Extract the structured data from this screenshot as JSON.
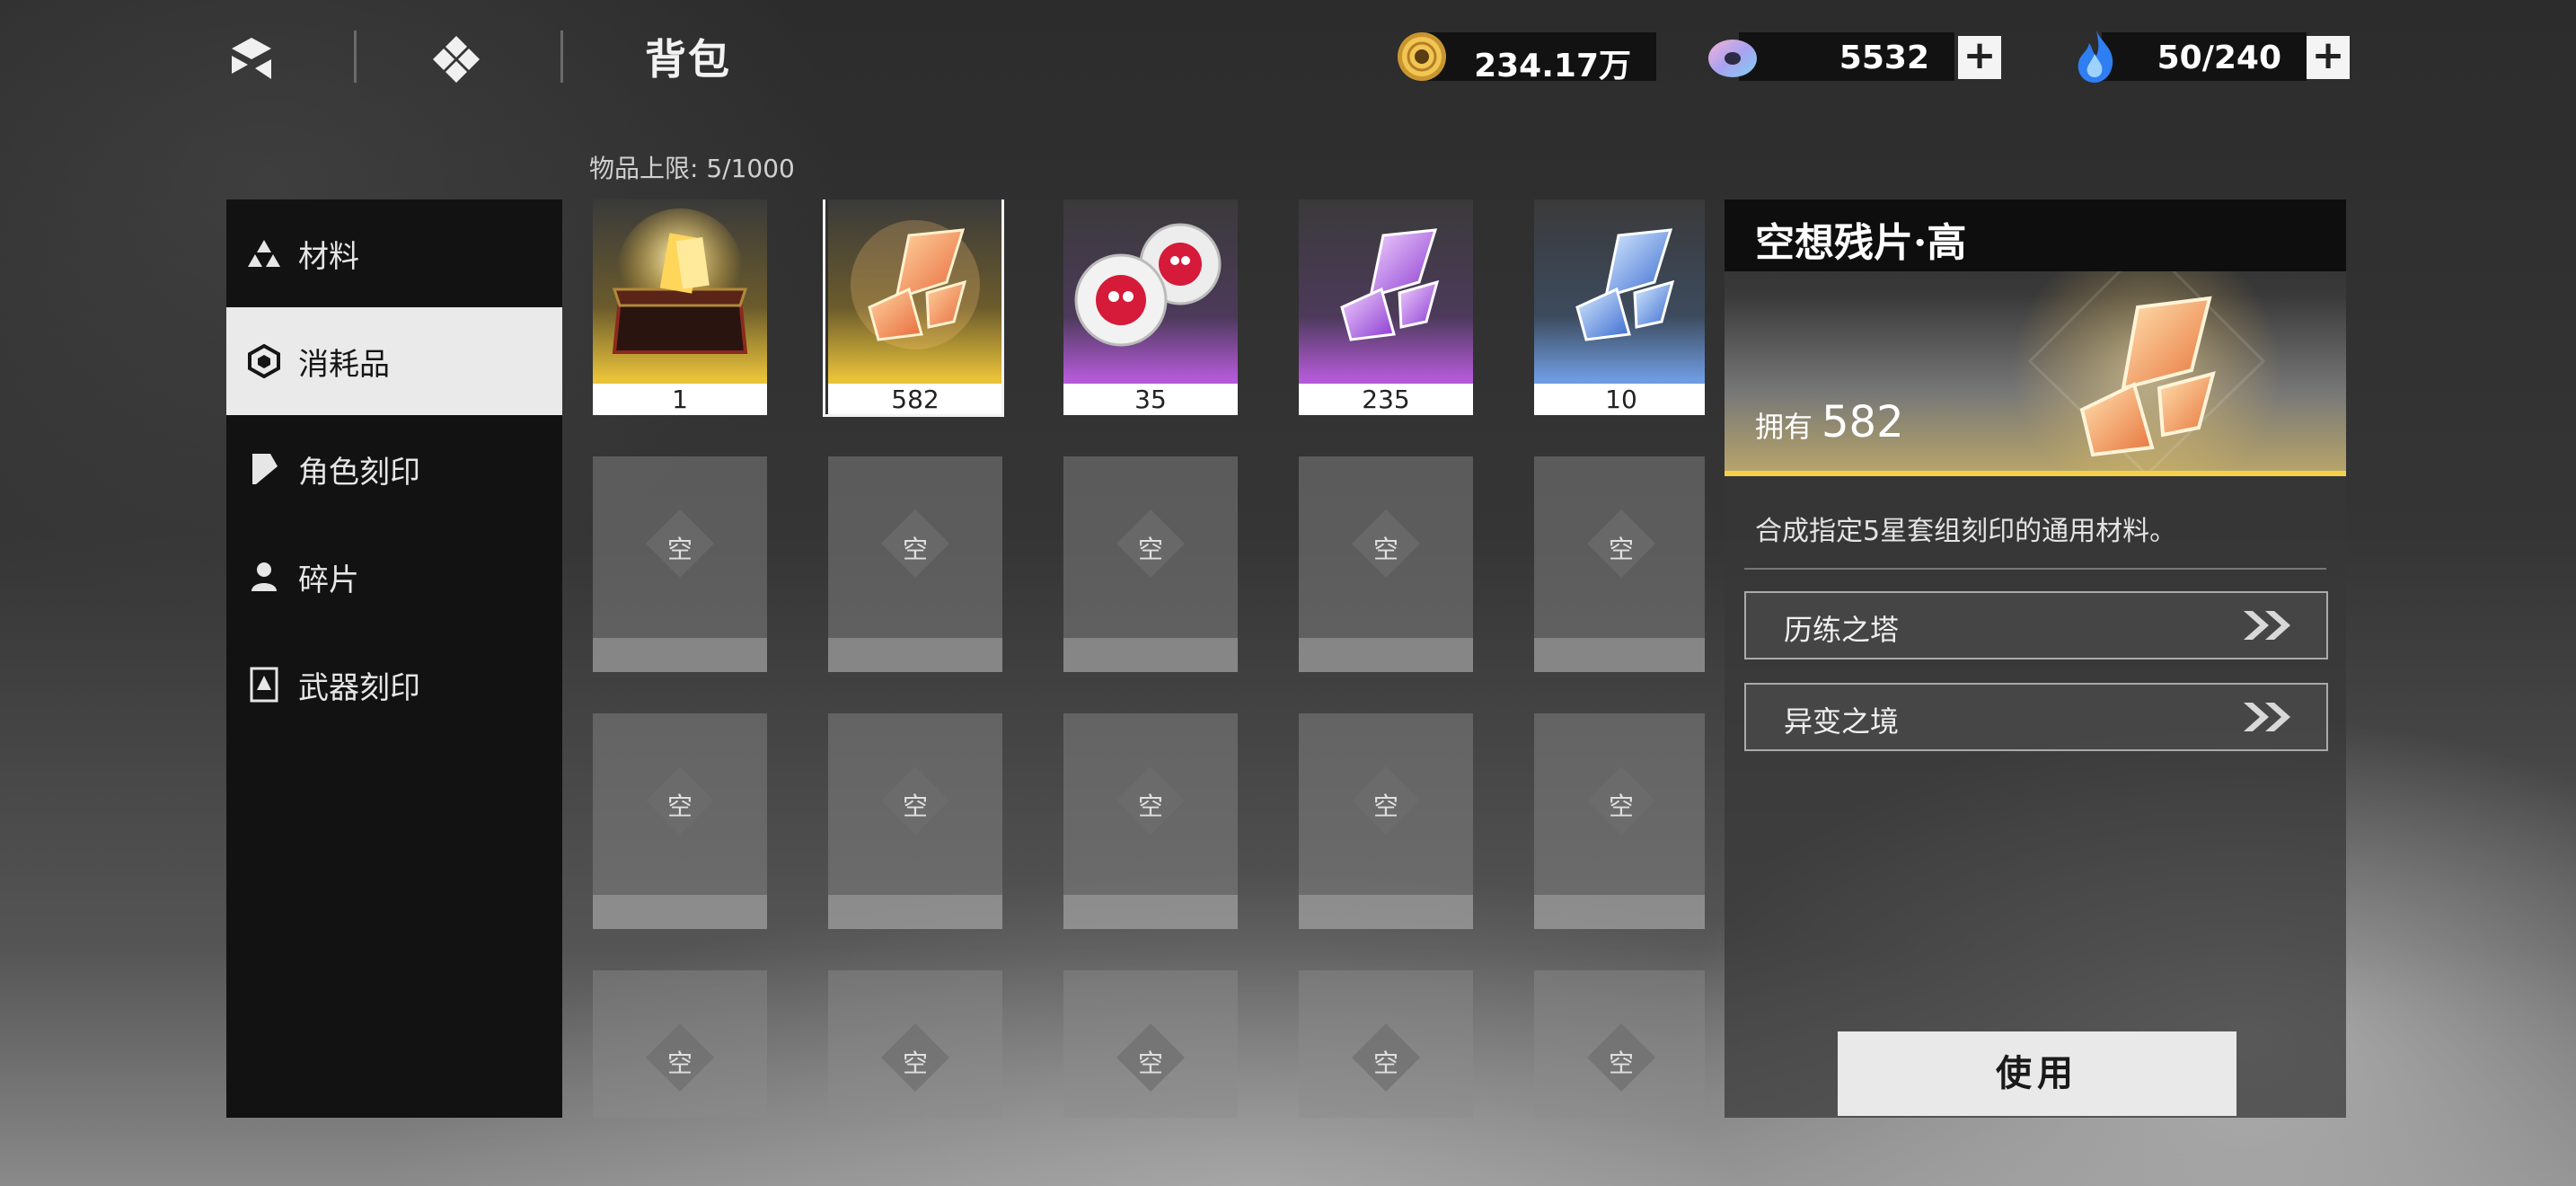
{
  "header": {
    "title": "背包"
  },
  "resources": [
    {
      "name": "gold-coin",
      "value": "234.17万",
      "has_plus": false
    },
    {
      "name": "crystal",
      "value": "5532",
      "has_plus": true
    },
    {
      "name": "stamina-flame",
      "value": "50/240",
      "has_plus": true
    }
  ],
  "plus_label": "+",
  "sidebar": {
    "items": [
      {
        "label": "材料",
        "icon": "triangles-icon",
        "active": false
      },
      {
        "label": "消耗品",
        "icon": "cube-icon",
        "active": true
      },
      {
        "label": "角色刻印",
        "icon": "shard-icon",
        "active": false
      },
      {
        "label": "碎片",
        "icon": "person-icon",
        "active": false
      },
      {
        "label": "武器刻印",
        "icon": "card-icon",
        "active": false
      }
    ]
  },
  "inventory": {
    "capacity": "物品上限: 5/1000",
    "items": [
      {
        "name": "golden-chest",
        "qty": "1",
        "rarity_color": "#e8c338"
      },
      {
        "name": "fantasy-shard-high",
        "qty": "582",
        "rarity_color": "#e8c338",
        "selected": true
      },
      {
        "name": "skull-orbs",
        "qty": "35",
        "rarity_color": "#b45ad8"
      },
      {
        "name": "fantasy-shard-purple",
        "qty": "235",
        "rarity_color": "#b45ad8"
      },
      {
        "name": "fantasy-shard-blue",
        "qty": "10",
        "rarity_color": "#6f9be0"
      }
    ],
    "empty_label": "空"
  },
  "detail": {
    "title": "空想残片·高",
    "own_label": "拥有",
    "own_count": "582",
    "description": "合成指定5星套组刻印的通用材料。",
    "sources": [
      {
        "label": "历练之塔"
      },
      {
        "label": "异变之境"
      }
    ],
    "use_label": "使用"
  }
}
